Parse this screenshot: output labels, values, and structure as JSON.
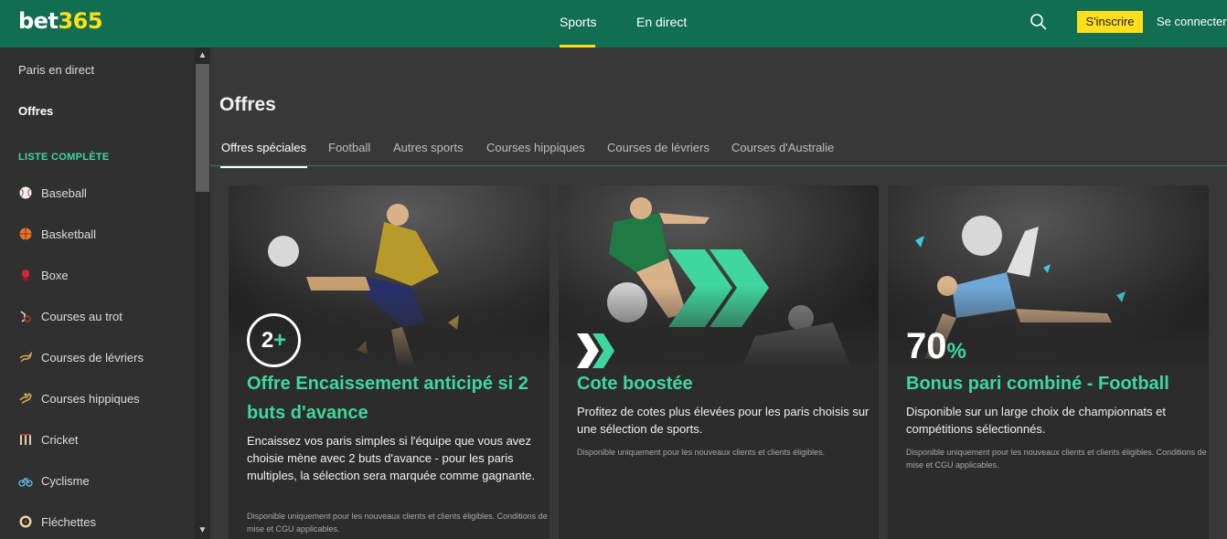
{
  "header": {
    "logo_part1": "bet",
    "logo_part2": "365",
    "nav": [
      "Sports",
      "En direct"
    ],
    "join_label": "S'inscrire",
    "login_label": "Se connecter",
    "search_icon": "search-icon",
    "brand_green": "#126e51",
    "accent_yellow": "#ffdf1b"
  },
  "sidebar": {
    "top_items": [
      "Paris en direct",
      "Offres"
    ],
    "heading": "LISTE COMPLÈTE",
    "sports": [
      {
        "label": "Baseball",
        "icon": "baseball-icon"
      },
      {
        "label": "Basketball",
        "icon": "basketball-icon"
      },
      {
        "label": "Boxe",
        "icon": "boxing-glove-icon"
      },
      {
        "label": "Courses au trot",
        "icon": "harness-racing-icon"
      },
      {
        "label": "Courses de lévriers",
        "icon": "greyhound-icon"
      },
      {
        "label": "Courses hippiques",
        "icon": "horse-racing-icon"
      },
      {
        "label": "Cricket",
        "icon": "cricket-icon"
      },
      {
        "label": "Cyclisme",
        "icon": "bicycle-icon"
      },
      {
        "label": "Fléchettes",
        "icon": "dartboard-icon"
      }
    ]
  },
  "main": {
    "title": "Offres",
    "tabs": [
      "Offres spéciales",
      "Football",
      "Autres sports",
      "Courses hippiques",
      "Courses de lévriers",
      "Courses d'Australie"
    ],
    "active_tab": "Offres spéciales",
    "accent_teal": "#3fd6a0",
    "cards": [
      {
        "badge_num": "2",
        "badge_plus": "+",
        "title": "Offre Encaissement anticipé si 2 buts d'avance",
        "desc": "Encaissez vos paris simples si l'équipe que vous avez choisie mène avec 2 buts d'avance - pour les paris multiples, la sélection sera marquée comme gagnante.",
        "fine": "Disponible uniquement pour les nouveaux clients et clients éligibles. Conditions de mise et CGU applicables."
      },
      {
        "title": "Cote boostée",
        "desc": "Profitez de cotes plus élevées pour les paris choisis sur une sélection de sports.",
        "fine": "Disponible uniquement pour les nouveaux clients et clients éligibles."
      },
      {
        "pct_num": "70",
        "pct_sign": "%",
        "title": "Bonus pari combiné - Football",
        "desc": "Disponible sur un large choix de championnats et compétitions sélectionnés.",
        "fine": "Disponible uniquement pour les nouveaux clients et clients éligibles. Conditions de mise et CGU applicables."
      }
    ]
  }
}
